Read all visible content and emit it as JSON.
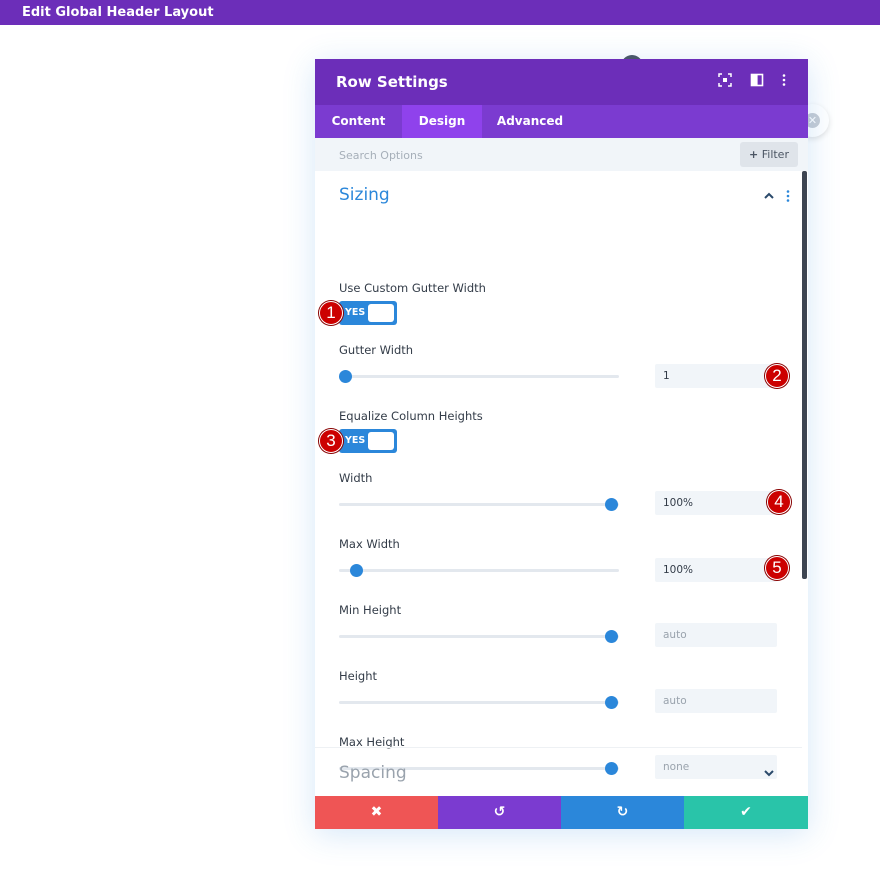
{
  "topbar": {
    "title": "Edit Global Header Layout"
  },
  "modal": {
    "title": "Row Settings",
    "header_icons": {
      "expand": "expand-icon",
      "layout": "sidebar-layout-icon",
      "more": "more-vertical-icon"
    },
    "tabs": [
      {
        "label": "Content",
        "active": false
      },
      {
        "label": "Design",
        "active": true
      },
      {
        "label": "Advanced",
        "active": false
      }
    ],
    "search": {
      "placeholder": "Search Options"
    },
    "filter": {
      "icon": "+",
      "label": "Filter"
    },
    "sizing": {
      "title": "Sizing",
      "custom_gutter": {
        "label": "Use Custom Gutter Width",
        "toggle_text": "YES",
        "badge": "1"
      },
      "gutter_width": {
        "label": "Gutter Width",
        "value": "1",
        "slider_fraction": 0.0,
        "badge": "2"
      },
      "equalize": {
        "label": "Equalize Column Heights",
        "toggle_text": "YES",
        "badge": "3"
      },
      "width": {
        "label": "Width",
        "value": "100%",
        "slider_fraction": 1.0,
        "badge": "4"
      },
      "max_width": {
        "label": "Max Width",
        "value": "100%",
        "slider_fraction": 0.04,
        "badge": "5"
      },
      "min_height": {
        "label": "Min Height",
        "value": "auto",
        "slider_fraction": 1.0
      },
      "height": {
        "label": "Height",
        "value": "auto",
        "slider_fraction": 1.0
      },
      "max_height": {
        "label": "Max Height",
        "value": "none",
        "slider_fraction": 1.0
      }
    },
    "spacing": {
      "title": "Spacing"
    },
    "footer": {
      "cancel": {
        "icon": "✖",
        "color": "#ef5555"
      },
      "undo": {
        "icon": "↺",
        "color": "#7b3bd0"
      },
      "redo": {
        "icon": "↻",
        "color": "#2b87da"
      },
      "save": {
        "icon": "✔",
        "color": "#29c4a9"
      }
    }
  },
  "colors": {
    "purple": "#6c2eb9",
    "tab_purple": "#7b3bd0",
    "active_tab": "#8f42ec",
    "blue": "#2b87da",
    "badge_red": "#cc0000"
  }
}
